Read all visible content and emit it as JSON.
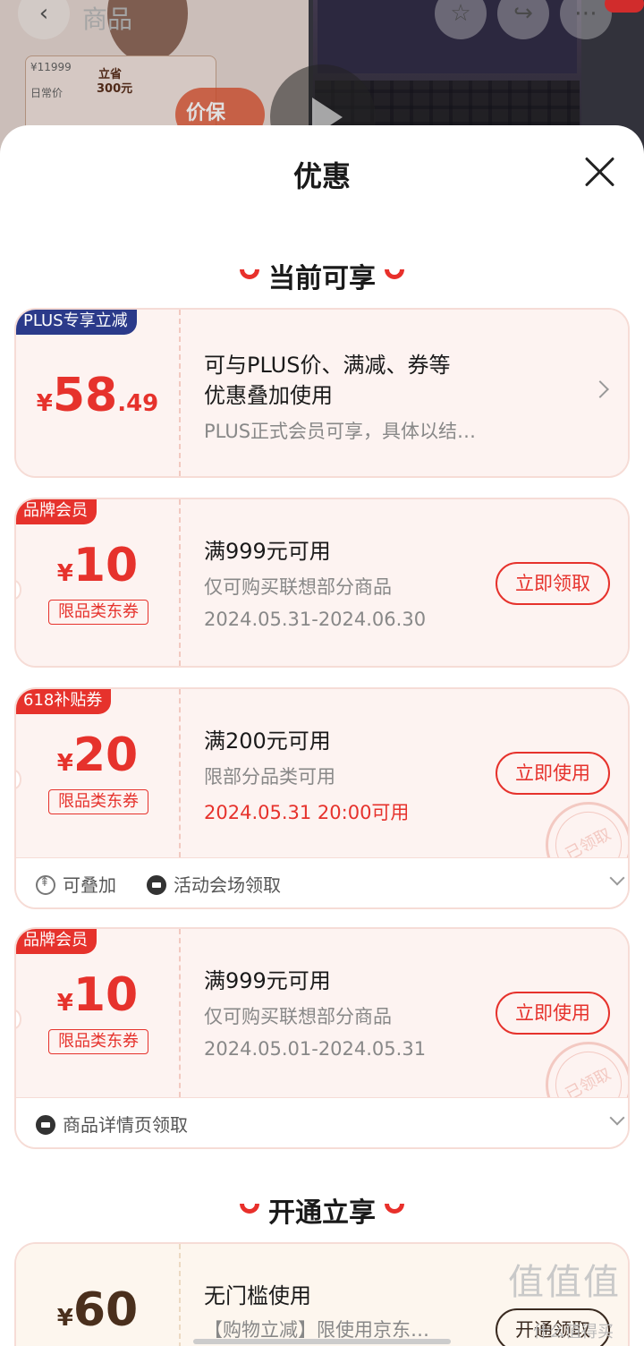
{
  "backdrop": {
    "title": "商品",
    "price": "¥11999",
    "daily": "日常价",
    "save_line1": "立省",
    "save_line2": "300元",
    "badge": "价保"
  },
  "sheet": {
    "title": "优惠",
    "section_current": "当前可享",
    "section_open": "开通立享"
  },
  "coupons": [
    {
      "tag": "PLUS专享立减",
      "currency": "¥",
      "amount": "58",
      "amount_decimal": ".49",
      "line1": "可与PLUS价、满减、券等",
      "line1b": "优惠叠加使用",
      "line2": "PLUS正式会员可享，具体以结…"
    },
    {
      "tag": "品牌会员",
      "currency": "¥",
      "amount": "10",
      "amount_tag": "限品类东券",
      "line1": "满999元可用",
      "line2": "仅可购买联想部分商品",
      "line3": "2024.05.31-2024.06.30",
      "button": "立即领取"
    },
    {
      "tag": "618补贴券",
      "currency": "¥",
      "amount": "20",
      "amount_tag": "限品类东券",
      "line1": "满200元可用",
      "line2": "限部分品类可用",
      "line3": "2024.05.31 20:00可用",
      "button": "立即使用",
      "stamp": "已领取",
      "foot1": "可叠加",
      "foot2": "活动会场领取"
    },
    {
      "tag": "品牌会员",
      "currency": "¥",
      "amount": "10",
      "amount_tag": "限品类东券",
      "line1": "满999元可用",
      "line2": "仅可购买联想部分商品",
      "line3": "2024.05.01-2024.05.31",
      "button": "立即使用",
      "stamp": "已领取",
      "foot1": "商品详情页领取"
    },
    {
      "currency": "¥",
      "amount": "60",
      "line1": "无门槛使用",
      "line2": "【购物立减】限使用京东…",
      "button": "开通领取"
    }
  ],
  "watermark": {
    "main": "值值值",
    "sub": "什么值得买"
  },
  "colors": {
    "accent": "#e6322c",
    "plus_tag": "#2b3a8a",
    "card_bg": "#fdf3f1"
  }
}
